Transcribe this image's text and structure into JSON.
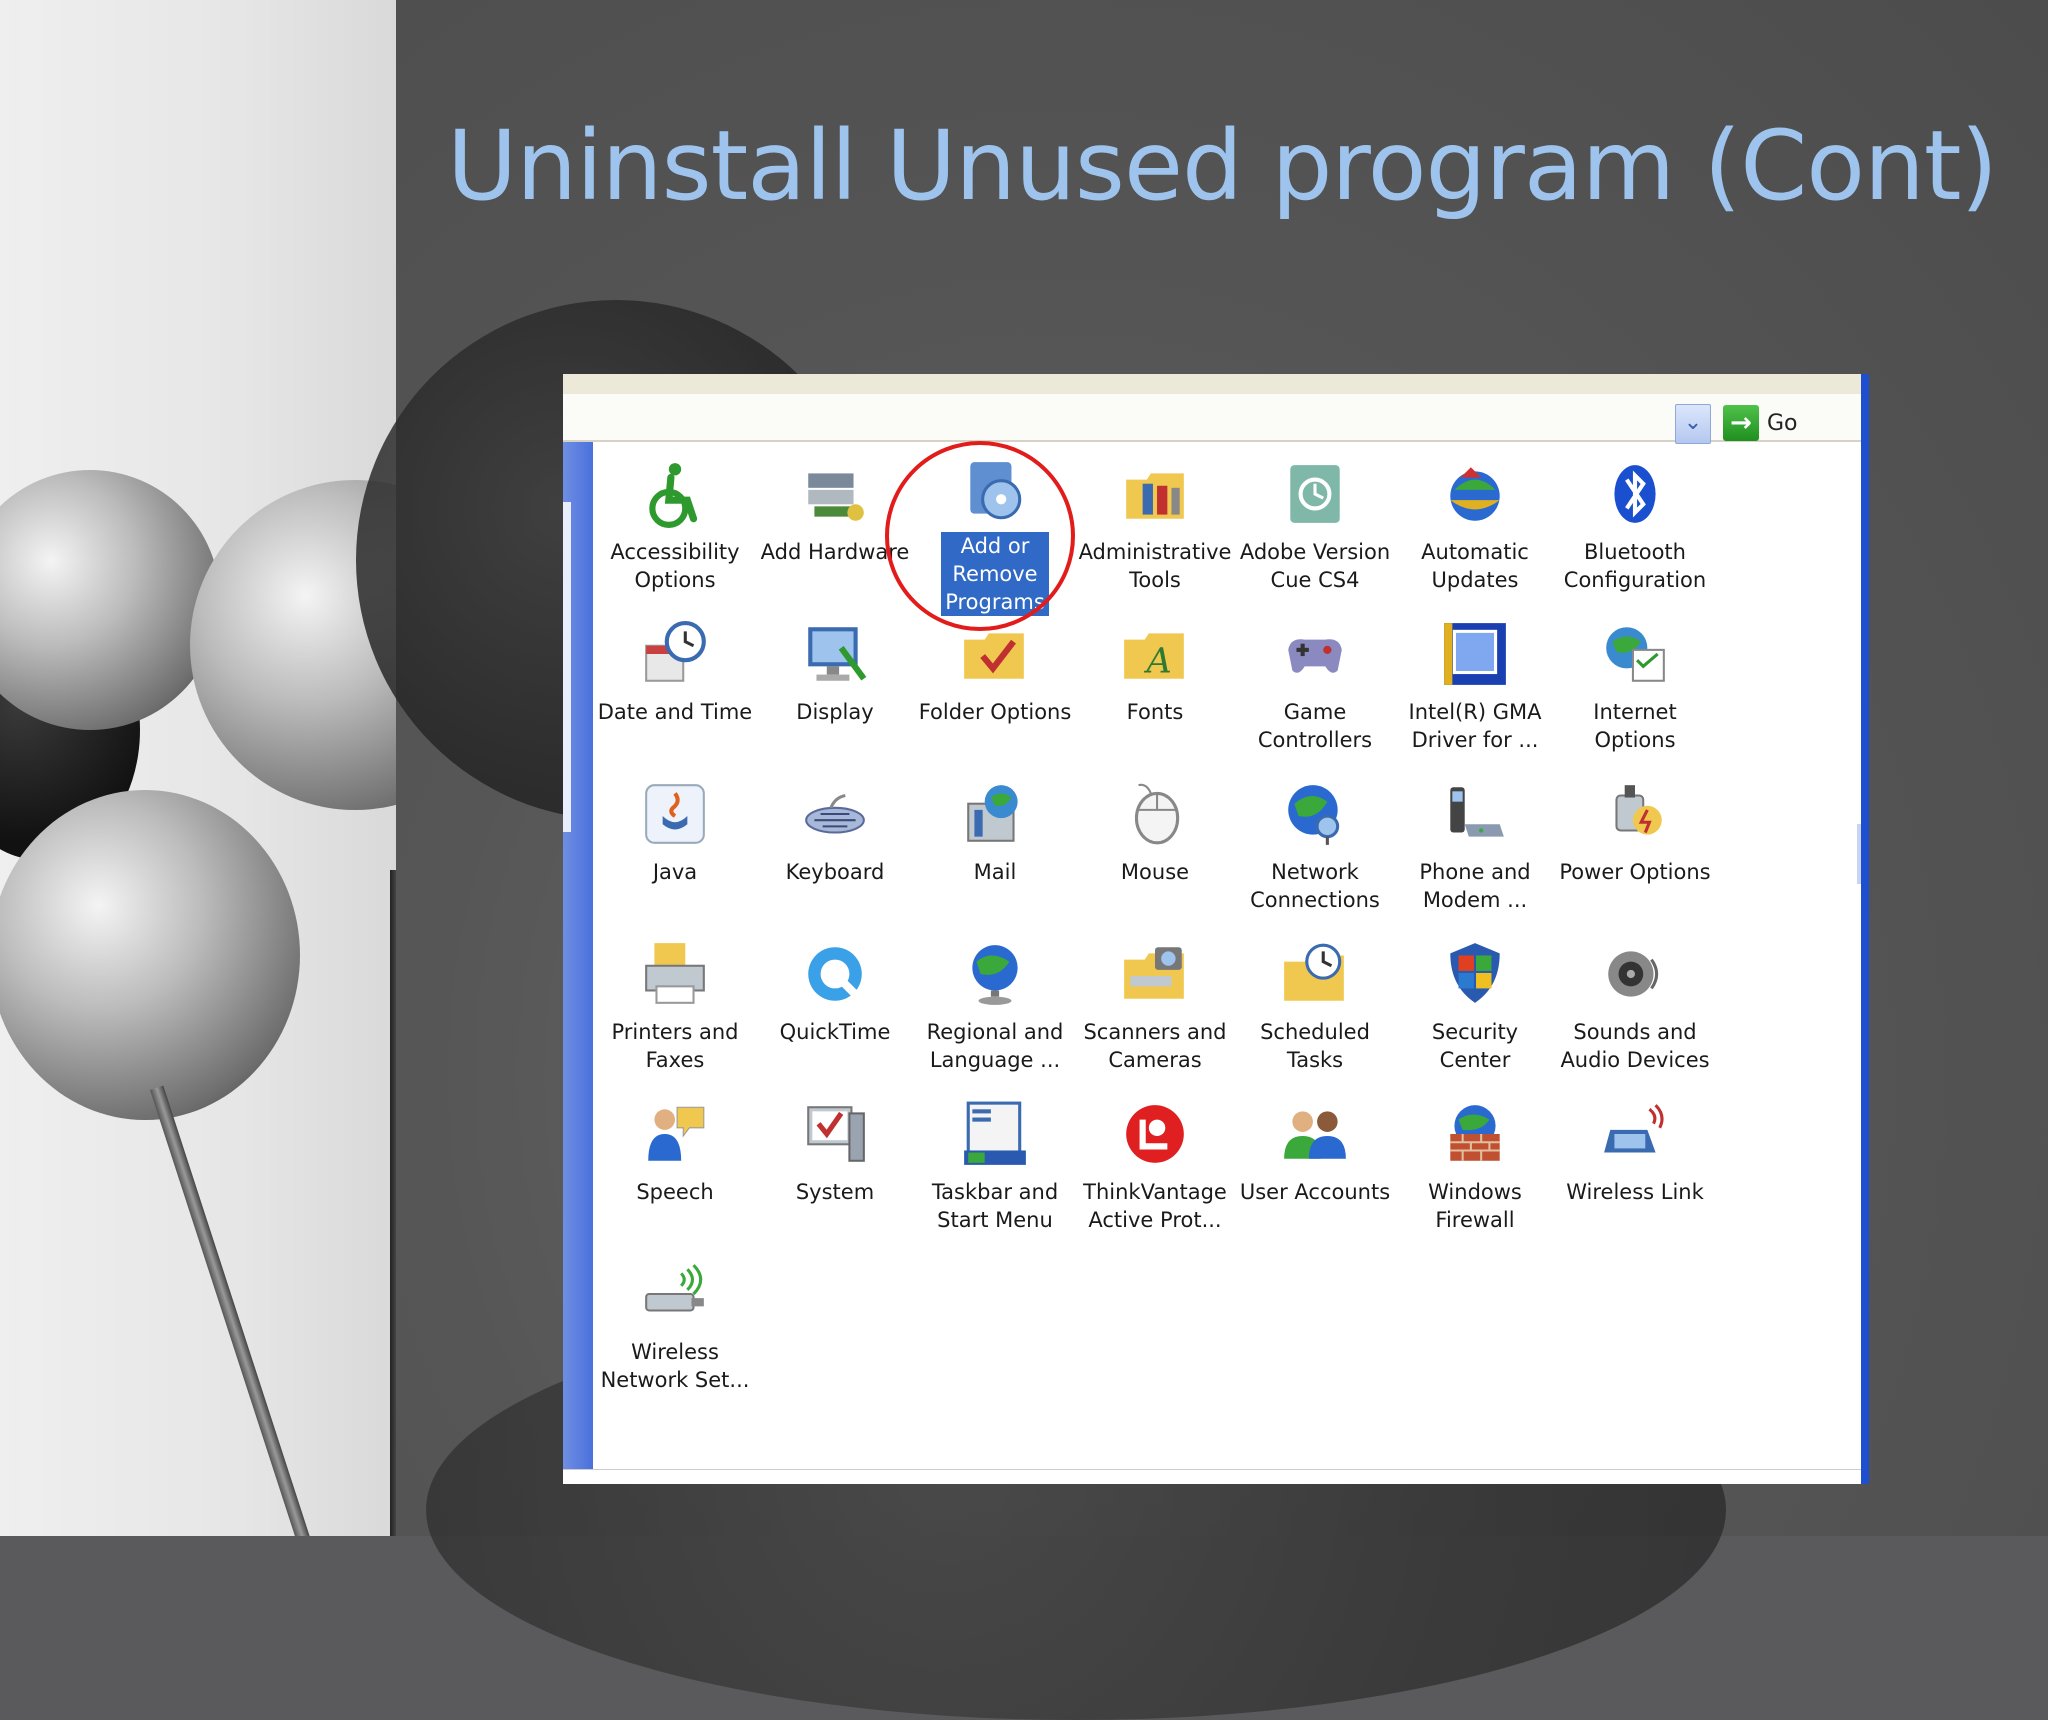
{
  "slide": {
    "title": "Uninstall Unused program (Cont)"
  },
  "address_bar": {
    "go_label": "Go"
  },
  "control_panel": {
    "items": [
      {
        "label": "Accessibility\nOptions",
        "icon": "accessibility-icon"
      },
      {
        "label": "Add Hardware",
        "icon": "add-hardware-icon"
      },
      {
        "label": "Add or\nRemove\nPrograms",
        "icon": "add-remove-programs-icon",
        "selected": true
      },
      {
        "label": "Administrative\nTools",
        "icon": "administrative-tools-icon"
      },
      {
        "label": "Adobe Version\nCue CS4",
        "icon": "adobe-version-cue-icon"
      },
      {
        "label": "Automatic\nUpdates",
        "icon": "automatic-updates-icon"
      },
      {
        "label": "Bluetooth\nConfiguration",
        "icon": "bluetooth-icon"
      },
      {
        "label": "Date and Time",
        "icon": "date-time-icon"
      },
      {
        "label": "Display",
        "icon": "display-icon"
      },
      {
        "label": "Folder Options",
        "icon": "folder-options-icon"
      },
      {
        "label": "Fonts",
        "icon": "fonts-icon"
      },
      {
        "label": "Game\nControllers",
        "icon": "game-controllers-icon"
      },
      {
        "label": "Intel(R) GMA\nDriver for ...",
        "icon": "intel-gma-icon"
      },
      {
        "label": "Internet\nOptions",
        "icon": "internet-options-icon"
      },
      {
        "label": "Java",
        "icon": "java-icon"
      },
      {
        "label": "Keyboard",
        "icon": "keyboard-icon"
      },
      {
        "label": "Mail",
        "icon": "mail-icon"
      },
      {
        "label": "Mouse",
        "icon": "mouse-icon"
      },
      {
        "label": "Network\nConnections",
        "icon": "network-connections-icon"
      },
      {
        "label": "Phone and\nModem ...",
        "icon": "phone-modem-icon"
      },
      {
        "label": "Power Options",
        "icon": "power-options-icon"
      },
      {
        "label": "Printers and\nFaxes",
        "icon": "printers-faxes-icon"
      },
      {
        "label": "QuickTime",
        "icon": "quicktime-icon"
      },
      {
        "label": "Regional and\nLanguage ...",
        "icon": "regional-language-icon"
      },
      {
        "label": "Scanners and\nCameras",
        "icon": "scanners-cameras-icon"
      },
      {
        "label": "Scheduled\nTasks",
        "icon": "scheduled-tasks-icon"
      },
      {
        "label": "Security\nCenter",
        "icon": "security-center-icon"
      },
      {
        "label": "Sounds and\nAudio Devices",
        "icon": "sounds-audio-icon"
      },
      {
        "label": "Speech",
        "icon": "speech-icon"
      },
      {
        "label": "System",
        "icon": "system-icon"
      },
      {
        "label": "Taskbar and\nStart Menu",
        "icon": "taskbar-start-menu-icon"
      },
      {
        "label": "ThinkVantage\nActive Prot...",
        "icon": "thinkvantage-icon"
      },
      {
        "label": "User Accounts",
        "icon": "user-accounts-icon"
      },
      {
        "label": "Windows\nFirewall",
        "icon": "windows-firewall-icon"
      },
      {
        "label": "Wireless Link",
        "icon": "wireless-link-icon"
      },
      {
        "label": "Wireless\nNetwork Set...",
        "icon": "wireless-network-setup-icon"
      }
    ]
  },
  "colors": {
    "title": "#9ec4ee",
    "selection": "#3169c6",
    "highlight_circle": "#e21b1b",
    "window_border": "#1d4fd0"
  }
}
